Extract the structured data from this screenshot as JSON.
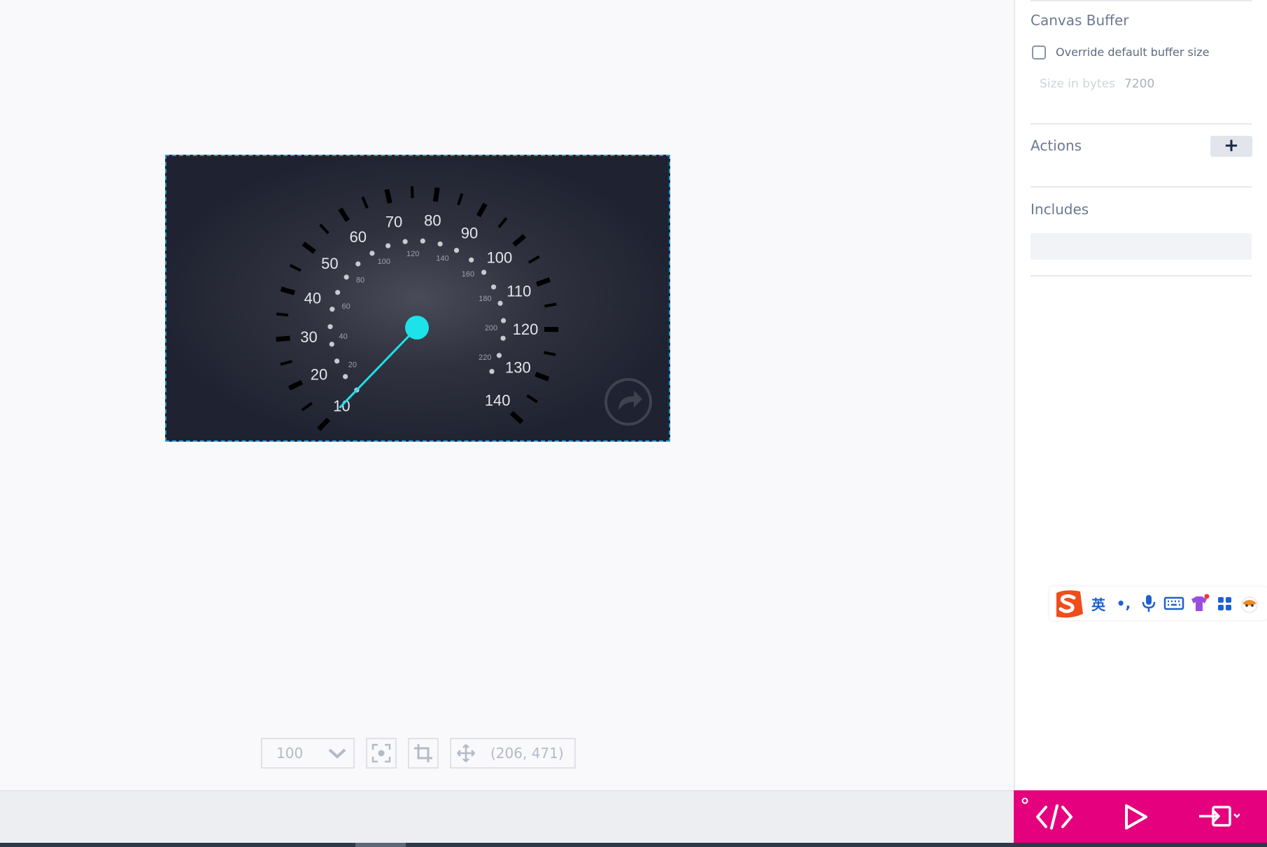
{
  "gauge": {
    "outer_labels": [
      "10",
      "20",
      "30",
      "40",
      "50",
      "60",
      "70",
      "80",
      "90",
      "100",
      "110",
      "120",
      "130",
      "140"
    ],
    "inner_labels": [
      "20",
      "40",
      "60",
      "80",
      "100",
      "120",
      "140",
      "160",
      "180",
      "200",
      "220"
    ],
    "needle_value": 10,
    "needle_color": "#1de2ea",
    "restart_icon": "rotate-cw-icon"
  },
  "toolbar": {
    "zoom_value": "100",
    "zoom_dropdown_icon": "chevron-down-icon",
    "fit_icon": "focus-icon",
    "crop_icon": "crop-icon",
    "move_icon": "move-icon",
    "coords": "(206, 471)"
  },
  "panel": {
    "canvas_buffer_title": "Canvas Buffer",
    "override_label": "Override default buffer size",
    "override_checked": false,
    "size_label": "Size in bytes",
    "size_value": "7200",
    "actions_title": "Actions",
    "add_label": "+",
    "includes_title": "Includes"
  },
  "ime": {
    "items": [
      "英",
      "•,",
      "mic-icon",
      "keyboard-icon",
      "shirt-icon",
      "apps-icon",
      "mascot-icon"
    ],
    "first_label": "英",
    "punct_label": "•,"
  },
  "action_bar": {
    "code_icon": "code-icon",
    "run_icon": "play-icon",
    "export_icon": "export-icon",
    "color": "#e5007e"
  }
}
